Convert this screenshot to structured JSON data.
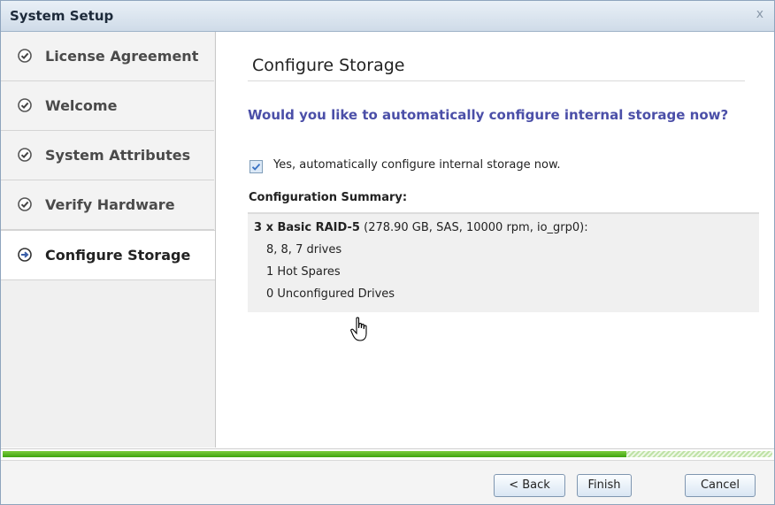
{
  "window": {
    "title": "System Setup",
    "close_label": "x"
  },
  "sidebar": {
    "steps": [
      {
        "label": "License Agreement",
        "state": "done",
        "icon": "check-circle-icon"
      },
      {
        "label": "Welcome",
        "state": "done",
        "icon": "check-circle-icon"
      },
      {
        "label": "System Attributes",
        "state": "done",
        "icon": "check-circle-icon"
      },
      {
        "label": "Verify Hardware",
        "state": "done",
        "icon": "check-circle-icon"
      },
      {
        "label": "Configure Storage",
        "state": "active",
        "icon": "arrow-right-circle-icon"
      }
    ]
  },
  "main": {
    "heading": "Configure Storage",
    "question": "Would you like to automatically configure internal storage now?",
    "checkbox": {
      "label": "Yes, automatically configure internal storage now.",
      "checked": true
    },
    "summary_title": "Configuration Summary:",
    "summary": {
      "raid_bold": "3 x Basic RAID-5",
      "raid_detail": " (278.90 GB, SAS, 10000 rpm, io_grp0):",
      "lines": [
        "8, 8, 7 drives",
        "1 Hot Spares",
        "0 Unconfigured Drives"
      ]
    }
  },
  "progress": {
    "fraction": 0.81
  },
  "footer": {
    "back_label": "< Back",
    "finish_label": "Finish",
    "cancel_label": "Cancel"
  },
  "colors": {
    "question": "#4b4fa8",
    "progress": "#4fb51c",
    "check": "#2e7d32"
  }
}
